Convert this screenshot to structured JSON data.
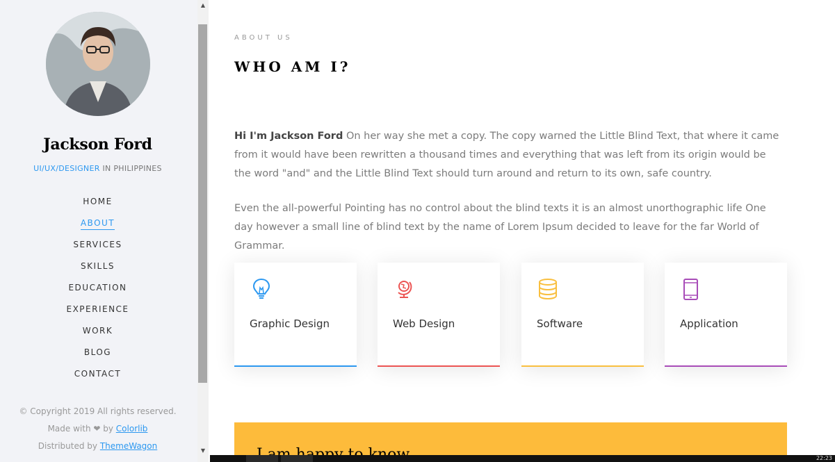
{
  "profile": {
    "name": "Jackson Ford",
    "role_accent": "UI/UX/DESIGNER",
    "role_rest": " IN PHILIPPINES"
  },
  "nav": [
    {
      "label": "HOME",
      "active": false
    },
    {
      "label": "ABOUT",
      "active": true
    },
    {
      "label": "SERVICES",
      "active": false
    },
    {
      "label": "SKILLS",
      "active": false
    },
    {
      "label": "EDUCATION",
      "active": false
    },
    {
      "label": "EXPERIENCE",
      "active": false
    },
    {
      "label": "WORK",
      "active": false
    },
    {
      "label": "BLOG",
      "active": false
    },
    {
      "label": "CONTACT",
      "active": false
    }
  ],
  "footer": {
    "copyright": "© Copyright 2019 All rights reserved.",
    "made_with_prefix": "Made with ",
    "heart": "❤",
    "made_with_by": " by ",
    "colorlib": "Colorlib",
    "distributed_prefix": "Distributed by ",
    "themewagon": "ThemeWagon"
  },
  "scrollbar": {
    "up_glyph": "▲",
    "down_glyph": "▼"
  },
  "about": {
    "eyebrow": "ABOUT US",
    "heading": "WHO AM I?",
    "intro_bold": "Hi I'm Jackson Ford",
    "intro_text": " On her way she met a copy. The copy warned the Little Blind Text, that where it came from it would have been rewritten a thousand times and everything that was left from its origin would be the word \"and\" and the Little Blind Text should turn around and return to its own, safe country.",
    "para2": "Even the all-powerful Pointing has no control about the blind texts it is an almost unorthographic life One day however a small line of blind text by the name of Lorem Ipsum decided to leave for the far World of Grammar."
  },
  "services": [
    {
      "label": "Graphic Design",
      "icon": "lightbulb-icon",
      "color": "#2c98f0"
    },
    {
      "label": "Web Design",
      "icon": "globe-icon",
      "color": "#ec5453"
    },
    {
      "label": "Software",
      "icon": "database-icon",
      "color": "#f9bf3f"
    },
    {
      "label": "Application",
      "icon": "mobile-icon",
      "color": "#a84cb8"
    }
  ],
  "banner": {
    "color": "#fdbb3b",
    "text": "I am happy to know"
  },
  "taskbar": {
    "clock": "22:23"
  }
}
